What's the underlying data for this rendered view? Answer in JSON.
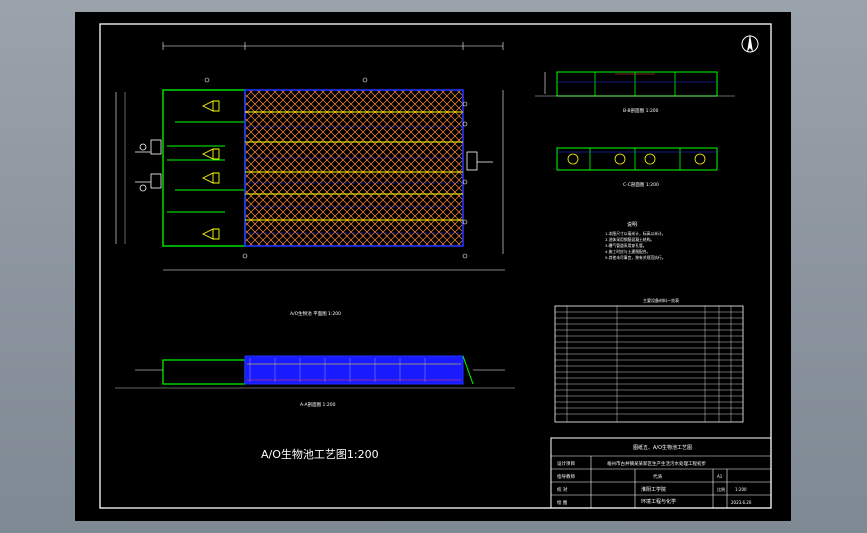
{
  "drawing": {
    "main_title": "A/O生物池工艺图1:200",
    "plan_caption": "A/O生物池 平面图 1:200",
    "section_aa_caption": "A-A剖面图 1:200",
    "section_bb_caption": "B-B剖面图 1:200",
    "section_cc_caption": "C-C剖面图 1:200",
    "notes_title": "说明",
    "notes": [
      "1.本图尺寸以毫米计，标高以米计。",
      "2.池体采用钢筋混凝土结构。",
      "3.曝气管道采用穿孔管。",
      "4.施工时应与土建图配合。",
      "5.其他未尽事宜，按有关规范执行。"
    ],
    "table_title": "主要设备材料一览表"
  },
  "title_block": {
    "drawing_name": "图纸五、A/O生物池工艺图",
    "project_label": "设计项目",
    "project_name": "亳州市古井镇某某新区生产生活污水处理工程初步",
    "designer_label": "指导教师",
    "designer_name": "代涛",
    "school": "淮阴工学院",
    "department": "环境工程与化学",
    "scale_label": "比例",
    "scale_value": "1:200",
    "sheet_size": "A1",
    "date": "2023.6.20",
    "draw_label": "绘 图",
    "check_label": "审 核",
    "row_check_label": "校 对"
  },
  "colors": {
    "sheet": "#000000",
    "frame": "#ffffff",
    "wall": "#00ff00",
    "aeration": "#ff8040",
    "mesh": "#ffb060",
    "blue": "#2233ff",
    "yellow": "#ffff00",
    "cyan": "#00ffff"
  },
  "icons": [
    "north-arrow-icon"
  ]
}
